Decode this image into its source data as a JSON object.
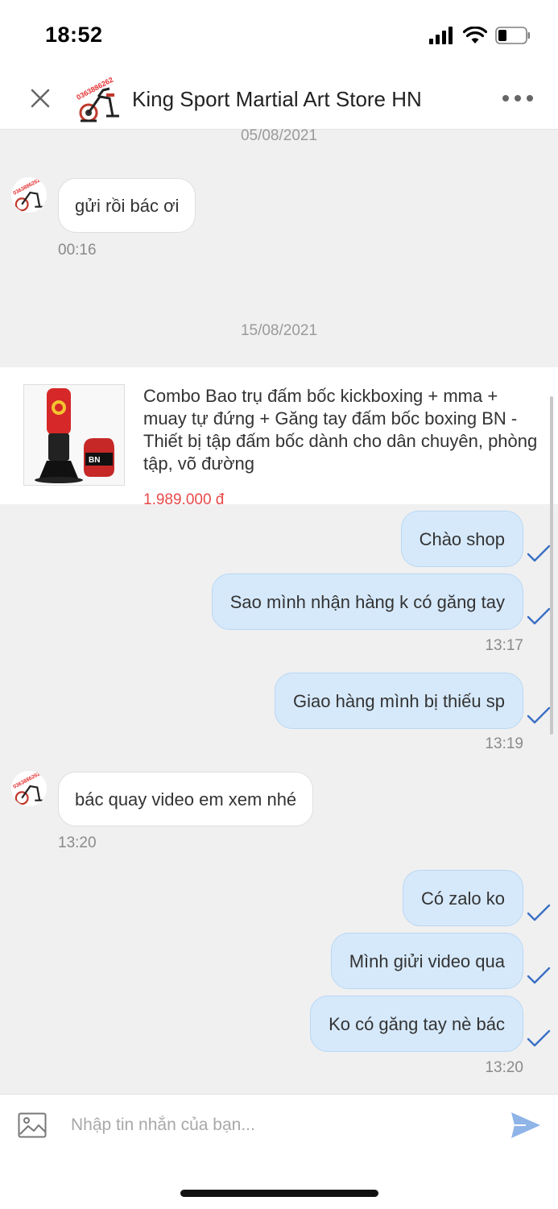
{
  "status_bar": {
    "time": "18:52"
  },
  "header": {
    "shop_name": "King Sport Martial Art Store HN",
    "avatar_text": "0363886262"
  },
  "chat": {
    "date_1": "05/08/2021",
    "msg_1": {
      "text": "gửi rồi bác ơi",
      "time": "00:16"
    },
    "date_2": "15/08/2021",
    "product": {
      "title": "Combo Bao trụ đấm bốc kickboxing + mma + muay tự đứng + Găng tay đấm bốc boxing BN - Thiết bị tập đấm bốc dành cho dân chuyên, phòng tập, võ đường",
      "price": "1.989.000 đ"
    },
    "msg_2": {
      "text": "Chào shop"
    },
    "msg_3": {
      "text": "Sao mình nhận hàng k có găng tay",
      "time": "13:17"
    },
    "msg_4": {
      "text": "Giao hàng mình bị thiếu sp",
      "time": "13:19"
    },
    "msg_5": {
      "text": "bác quay video em xem nhé",
      "time": "13:20"
    },
    "msg_6": {
      "text": "Có zalo ko"
    },
    "msg_7": {
      "text": "Mình giửi video qua"
    },
    "msg_8": {
      "text": "Ko có găng tay nè bác",
      "time": "13:20"
    }
  },
  "input": {
    "placeholder": "Nhập tin nhắn của bạn..."
  },
  "colors": {
    "accent": "#3a6fc4",
    "out_bubble": "#d6e9fb",
    "price": "#e84a4a"
  }
}
